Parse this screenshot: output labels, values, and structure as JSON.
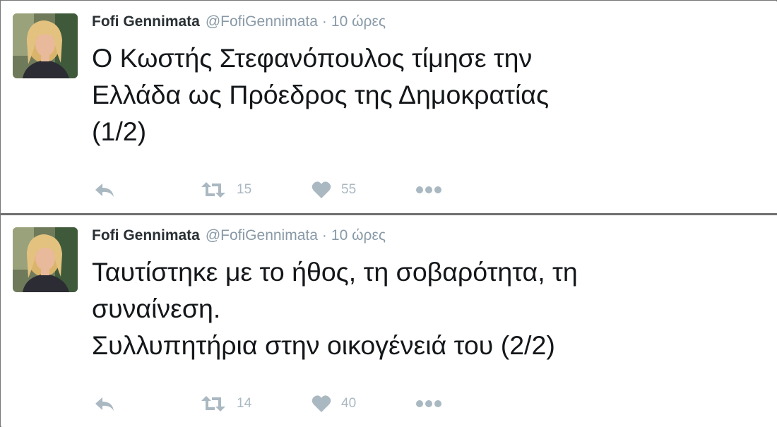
{
  "tweets": [
    {
      "author_name": "Fofi Gennimata",
      "handle": "@FofiGennimata",
      "separator": "·",
      "time": "10 ώρες",
      "text": "Ο Κωστής Στεφανόπουλος τίμησε την\nΕλλάδα ως Πρόεδρος της Δημοκρατίας\n(1/2)",
      "retweet_count": "15",
      "like_count": "55"
    },
    {
      "author_name": "Fofi Gennimata",
      "handle": "@FofiGennimata",
      "separator": "·",
      "time": "10 ώρες",
      "text": "Ταυτίστηκε με το ήθος, τη σοβαρότητα, τη\nσυναίνεση.\nΣυλλυπητήρια στην οικογένειά του (2/2)",
      "retweet_count": "14",
      "like_count": "40"
    }
  ],
  "icons": {
    "reply": "reply-icon",
    "retweet": "retweet-icon",
    "like": "heart-icon",
    "more": "more-dots-icon"
  },
  "colors": {
    "name": "#292f33",
    "muted": "#8899a6",
    "icon": "#aab8c2",
    "text": "#14171a"
  }
}
